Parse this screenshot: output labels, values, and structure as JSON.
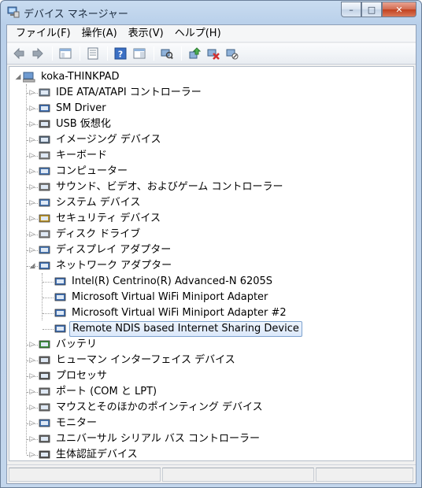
{
  "window": {
    "title": "デバイス マネージャー",
    "minimize_icon": "minimize-icon",
    "maximize_icon": "maximize-icon",
    "close_icon": "close-icon",
    "minimize_glyph": "–",
    "maximize_glyph": "□",
    "close_glyph": "✕"
  },
  "menubar": {
    "items": [
      "ファイル(F)",
      "操作(A)",
      "表示(V)",
      "ヘルプ(H)"
    ]
  },
  "toolbar": {
    "buttons": [
      "back-icon",
      "forward-icon",
      "show-hide-tree-icon",
      "properties-icon",
      "help-icon",
      "action-pane-icon",
      "scan-hardware-icon",
      "update-driver-icon",
      "uninstall-icon",
      "disable-icon"
    ]
  },
  "tree": {
    "root": "koka-THINKPAD",
    "categories": [
      "IDE ATA/ATAPI コントローラー",
      "SM Driver",
      "USB 仮想化",
      "イメージング デバイス",
      "キーボード",
      "コンピューター",
      "サウンド、ビデオ、およびゲーム コントローラー",
      "システム デバイス",
      "セキュリティ デバイス",
      "ディスク ドライブ",
      "ディスプレイ アダプター",
      "ネットワーク アダプター"
    ],
    "network_children": [
      "Intel(R) Centrino(R) Advanced-N 6205S",
      "Microsoft Virtual WiFi Miniport Adapter",
      "Microsoft Virtual WiFi Miniport Adapter #2",
      "Remote NDIS based Internet Sharing Device"
    ],
    "selected": "Remote NDIS based Internet Sharing Device",
    "categories_after": [
      "バッテリ",
      "ヒューマン インターフェイス デバイス",
      "プロセッサ",
      "ポート (COM と LPT)",
      "マウスとそのほかのポインティング デバイス",
      "モニター",
      "ユニバーサル シリアル バス コントローラー",
      "生体認証デバイス"
    ]
  },
  "colors": {
    "selection_border": "#7da2ce",
    "titlebar": "#c9dcf0",
    "close_button": "#c2421f"
  }
}
